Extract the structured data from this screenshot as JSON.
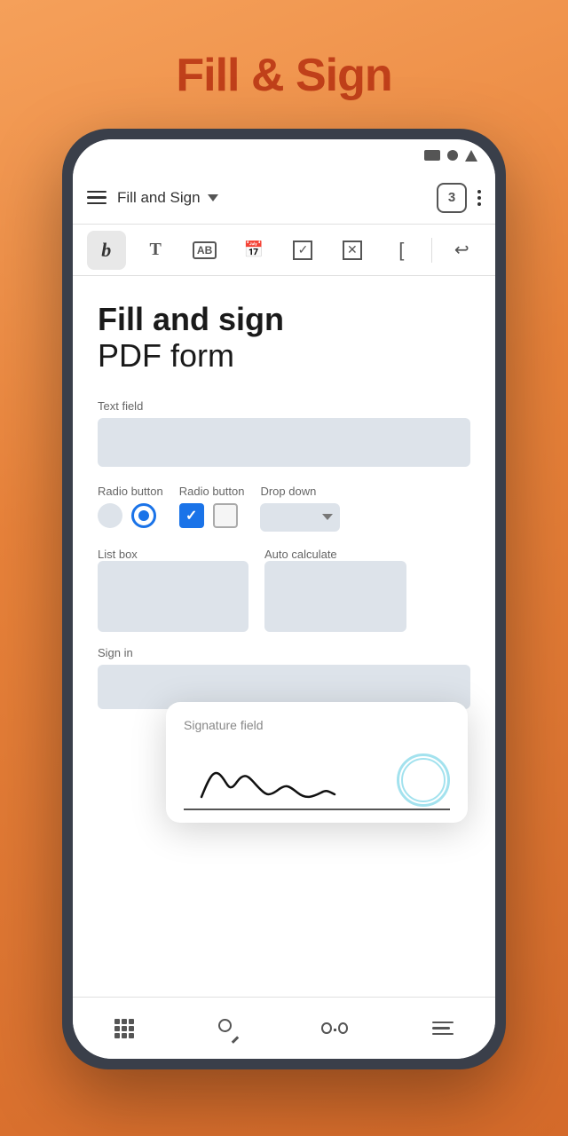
{
  "hero": {
    "title": "Fill & Sign"
  },
  "statusBar": {
    "icons": [
      "rectangle",
      "circle",
      "triangle"
    ]
  },
  "appBar": {
    "title": "Fill and Sign",
    "badge": "3"
  },
  "toolbar": {
    "tools": [
      {
        "id": "sign",
        "label": "Signature tool",
        "active": true
      },
      {
        "id": "text",
        "label": "Text tool"
      },
      {
        "id": "ab",
        "label": "AB box tool"
      },
      {
        "id": "calendar",
        "label": "Date tool"
      },
      {
        "id": "checkmark",
        "label": "Checkmark tool"
      },
      {
        "id": "xmark",
        "label": "X mark tool"
      },
      {
        "id": "bracket",
        "label": "Bracket tool"
      },
      {
        "id": "undo",
        "label": "Undo"
      }
    ]
  },
  "pdf": {
    "title_bold": "Fill and sign",
    "title_normal": "PDF form",
    "text_field_label": "Text field",
    "radio1_label": "Radio button",
    "radio2_label": "Radio button",
    "dropdown_label": "Drop down",
    "list_box_label": "List box",
    "auto_calc_label": "Auto calculate",
    "sign_in_label": "Sign in"
  },
  "signaturePopup": {
    "label": "Signature field"
  },
  "bottomNav": {
    "items": [
      {
        "id": "grid",
        "label": "Grid"
      },
      {
        "id": "search",
        "label": "Search"
      },
      {
        "id": "glasses",
        "label": "Read"
      },
      {
        "id": "list",
        "label": "List"
      }
    ]
  },
  "colors": {
    "accent": "#e8823a",
    "title_color": "#c0401a",
    "radio_blue": "#1a73e8",
    "checkbox_blue": "#1a73e8"
  }
}
